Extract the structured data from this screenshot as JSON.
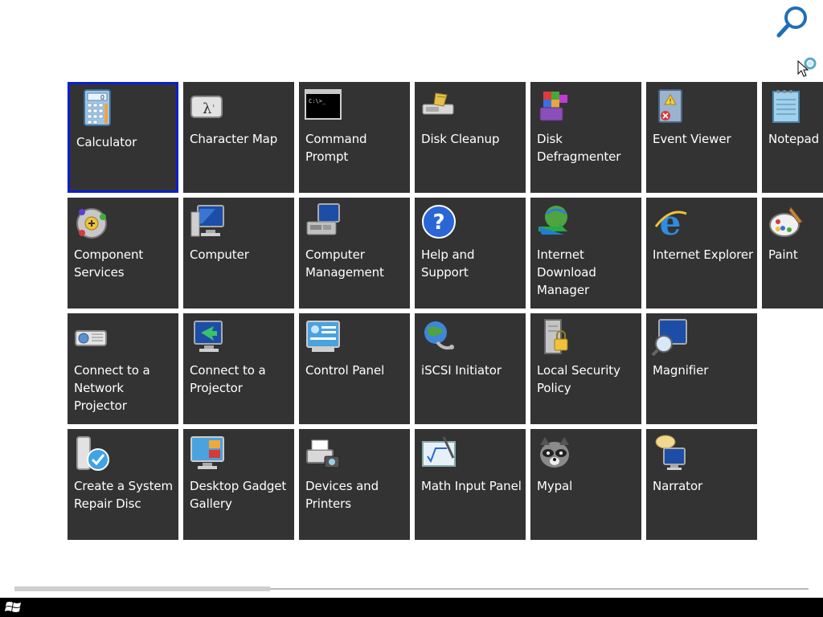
{
  "search": {
    "icon": "search-icon"
  },
  "cursor": {
    "icon": "busy-pointer-icon"
  },
  "tiles": [
    {
      "label": "Calculator",
      "icon": "calculator-icon",
      "selected": true
    },
    {
      "label": "Character Map",
      "icon": "character-map-icon"
    },
    {
      "label": "Command Prompt",
      "icon": "command-prompt-icon"
    },
    {
      "label": "Disk Cleanup",
      "icon": "disk-cleanup-icon"
    },
    {
      "label": "Disk Defragmenter",
      "icon": "disk-defragmenter-icon"
    },
    {
      "label": "Event Viewer",
      "icon": "event-viewer-icon"
    },
    {
      "label": "Notepad",
      "icon": "notepad-icon"
    },
    {
      "label": "Component Services",
      "icon": "component-services-icon"
    },
    {
      "label": "Computer",
      "icon": "computer-icon"
    },
    {
      "label": "Computer Management",
      "icon": "computer-management-icon"
    },
    {
      "label": "Help and Support",
      "icon": "help-icon"
    },
    {
      "label": "Internet Download Manager",
      "icon": "download-manager-icon"
    },
    {
      "label": "Internet Explorer",
      "icon": "internet-explorer-icon"
    },
    {
      "label": "Paint",
      "icon": "paint-icon"
    },
    {
      "label": "Connect to a Network Projector",
      "icon": "network-projector-icon"
    },
    {
      "label": "Connect to a Projector",
      "icon": "projector-icon"
    },
    {
      "label": "Control Panel",
      "icon": "control-panel-icon"
    },
    {
      "label": "iSCSI Initiator",
      "icon": "iscsi-initiator-icon"
    },
    {
      "label": "Local Security Policy",
      "icon": "security-policy-icon"
    },
    {
      "label": "Magnifier",
      "icon": "magnifier-icon"
    },
    {
      "label": "",
      "icon": ""
    },
    {
      "label": "Create a System Repair Disc",
      "icon": "repair-disc-icon"
    },
    {
      "label": "Desktop Gadget Gallery",
      "icon": "gadget-gallery-icon"
    },
    {
      "label": "Devices and Printers",
      "icon": "devices-printers-icon"
    },
    {
      "label": "Math Input Panel",
      "icon": "math-input-icon"
    },
    {
      "label": "Mypal",
      "icon": "mypal-icon"
    },
    {
      "label": "Narrator",
      "icon": "narrator-icon"
    }
  ],
  "scrollbar": {
    "position": 0
  },
  "taskbar": {
    "start_icon": "windows-logo-icon"
  }
}
